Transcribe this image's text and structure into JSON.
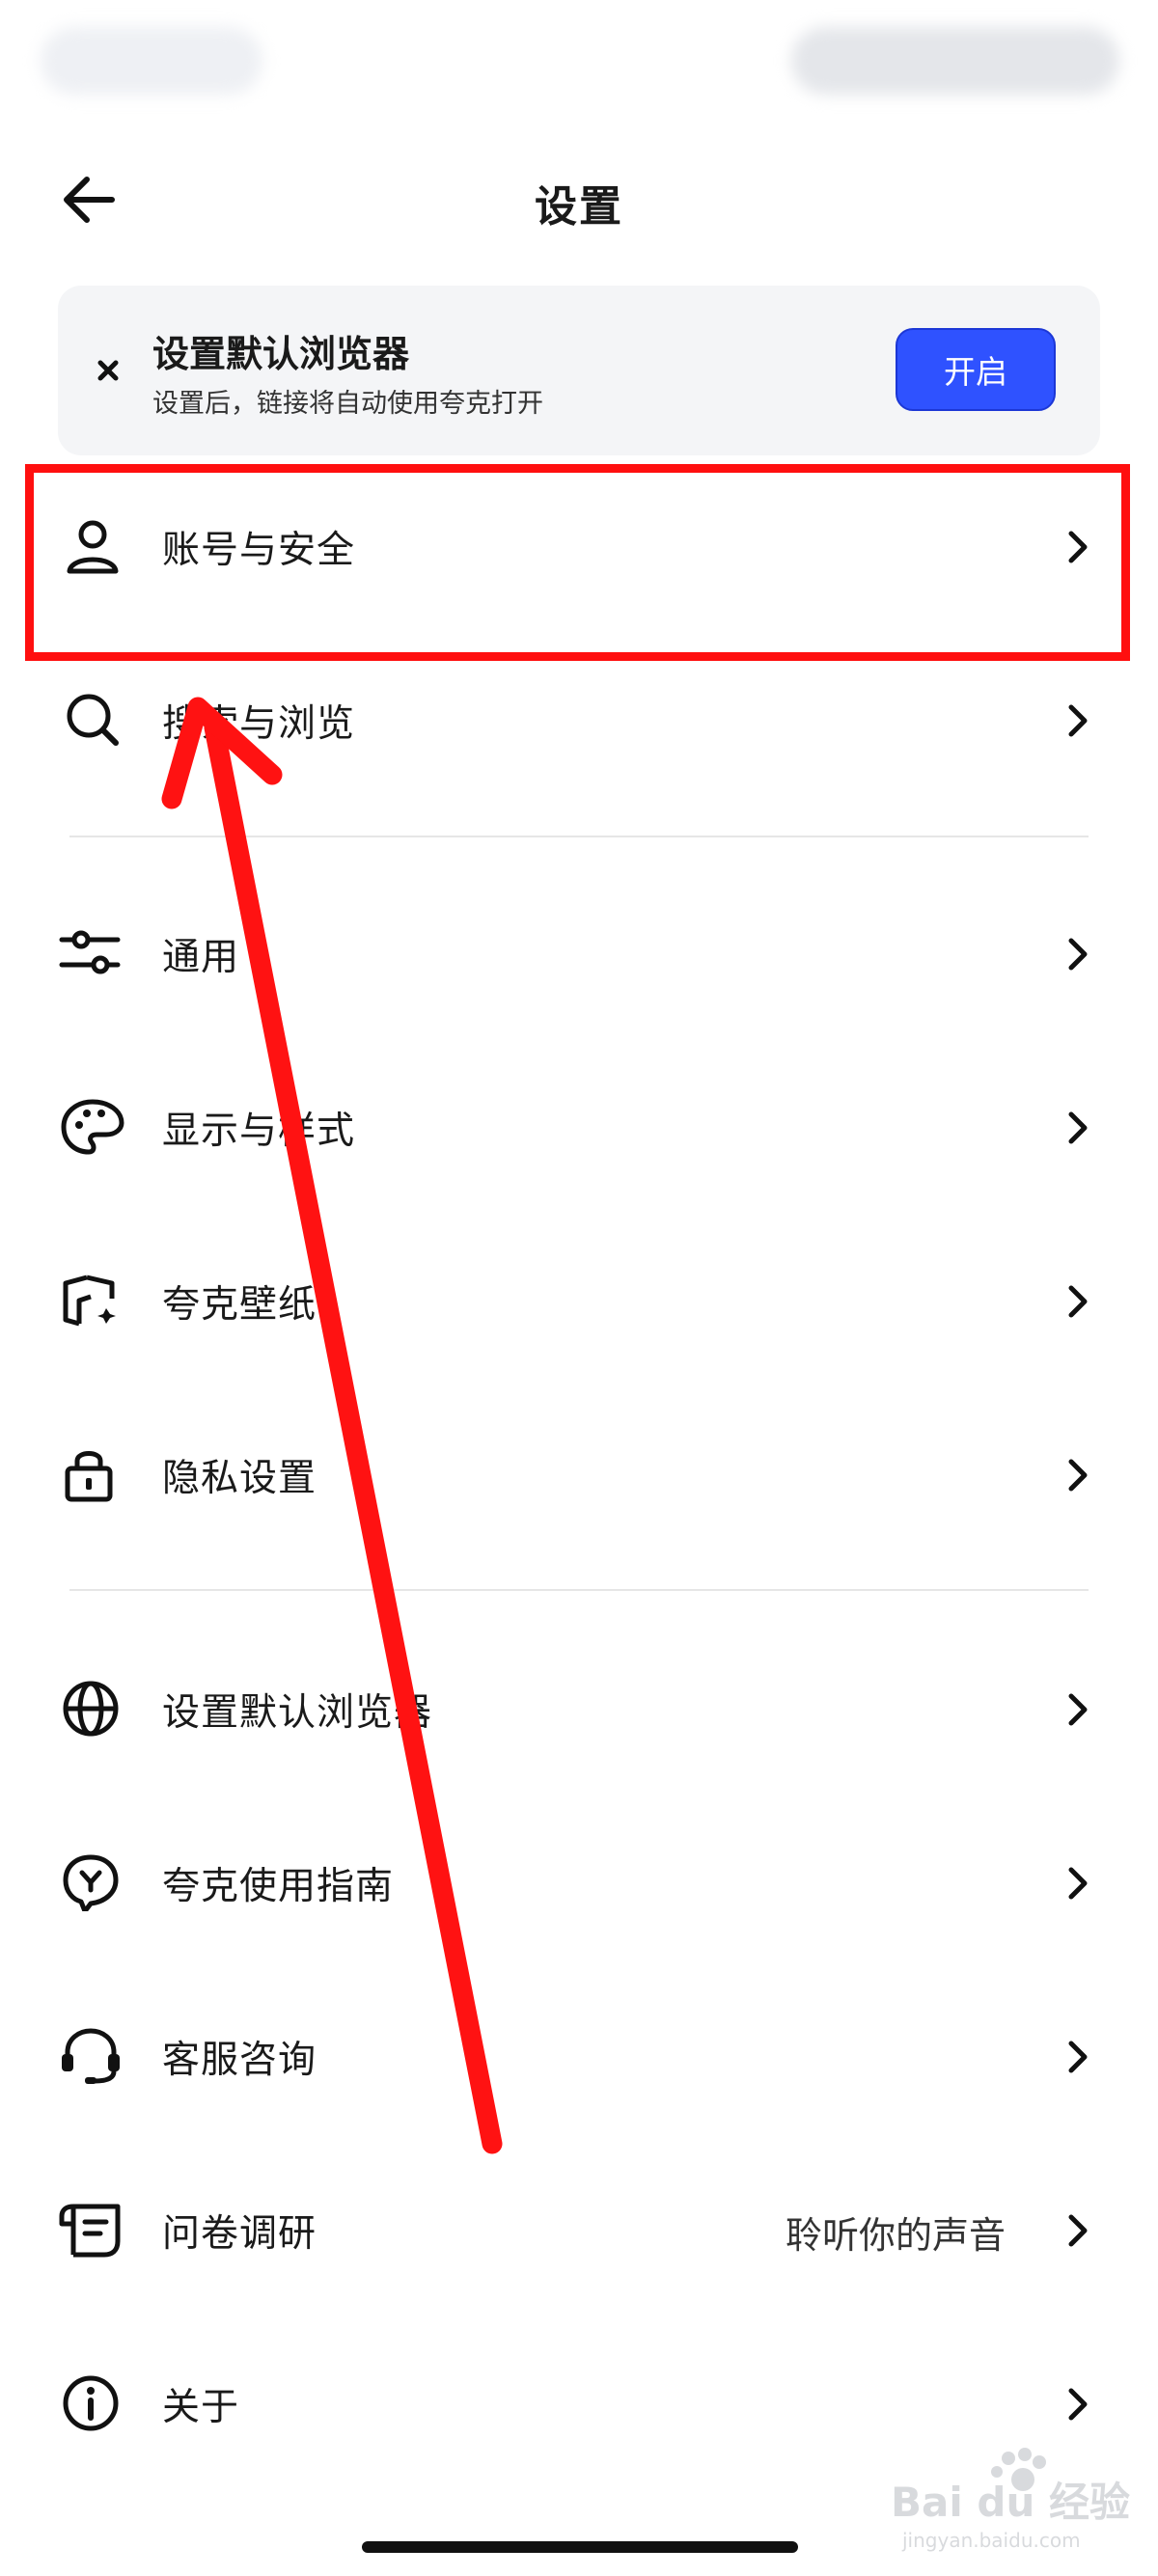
{
  "header": {
    "title": "设置",
    "back_icon": "arrow-left-icon"
  },
  "banner": {
    "title": "设置默认浏览器",
    "subtitle": "设置后，链接将自动使用夸克打开",
    "action_label": "开启",
    "action_color": "#2f52ff",
    "close_icon": "close-icon"
  },
  "menu": {
    "group1": [
      {
        "label": "账号与安全",
        "icon": "user-icon"
      },
      {
        "label": "搜索与浏览",
        "icon": "search-icon"
      }
    ],
    "group2": [
      {
        "label": "通用",
        "icon": "sliders-icon"
      },
      {
        "label": "显示与样式",
        "icon": "palette-icon"
      },
      {
        "label": "夸克壁纸",
        "icon": "wallpaper-icon"
      },
      {
        "label": "隐私设置",
        "icon": "lock-icon"
      }
    ],
    "group3": [
      {
        "label": "设置默认浏览器",
        "icon": "globe-icon"
      },
      {
        "label": "夸克使用指南",
        "icon": "guide-icon"
      },
      {
        "label": "客服咨询",
        "icon": "headset-icon"
      },
      {
        "label": "问卷调研",
        "icon": "survey-icon",
        "value": "聆听你的声音"
      },
      {
        "label": "关于",
        "icon": "info-icon"
      }
    ]
  },
  "annotation": {
    "highlight_color": "#ff0f0f"
  },
  "watermark": {
    "brand": "Baidu经验",
    "url": "jingyan.baidu.com"
  }
}
